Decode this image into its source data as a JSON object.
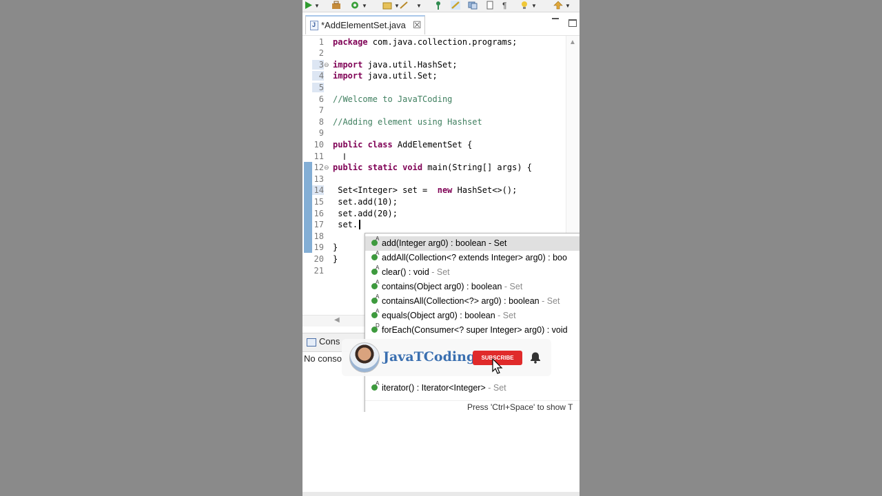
{
  "editor": {
    "tab_title": "*AddElementSet.java",
    "close_glyph": "☒"
  },
  "code": {
    "line_numbers": [
      "1",
      "2",
      "3",
      "4",
      "5",
      "6",
      "7",
      "8",
      "9",
      "10",
      "11",
      "12",
      "13",
      "14",
      "15",
      "16",
      "17",
      "18",
      "19",
      "20",
      "21"
    ],
    "lines": {
      "l1_kw": "package",
      "l1_rest": " com.java.collection.programs;",
      "l3_kw": "import",
      "l3_rest": " java.util.HashSet;",
      "l4_kw": "import",
      "l4_rest": " java.util.Set;",
      "l6": "//Welcome to JavaTCoding",
      "l8": "//Adding element using Hashset",
      "l10_kw": "public class",
      "l10_rest": " AddElementSet {",
      "l12_kw": "public static void",
      "l12_rest": " main(String[] args) {",
      "l14_a": " Set<Integer> set =  ",
      "l14_kw": "new",
      "l14_b": " HashSet<>();",
      "l15": " set.add(10);",
      "l16": " set.add(20);",
      "l17": " set.",
      "l19": "}",
      "l20": "}"
    }
  },
  "assist": {
    "items": [
      {
        "sig": "add(Integer arg0) : boolean",
        "owner": " - Set",
        "sup": "A"
      },
      {
        "sig": "addAll(Collection<? extends Integer> arg0) : boo",
        "owner": "",
        "sup": "A"
      },
      {
        "sig": "clear() : void",
        "owner": " - Set",
        "sup": "A"
      },
      {
        "sig": "contains(Object arg0) : boolean",
        "owner": " - Set",
        "sup": "A"
      },
      {
        "sig": "containsAll(Collection<?> arg0) : boolean",
        "owner": " - Set",
        "sup": "A"
      },
      {
        "sig": "equals(Object arg0) : boolean",
        "owner": " - Set",
        "sup": "A"
      },
      {
        "sig": "forEach(Consumer<? super Integer> arg0) : void",
        "owner": "",
        "sup": "D"
      },
      {
        "sig": "iterator() : Iterator<Integer>",
        "owner": " - Set",
        "sup": "A"
      }
    ],
    "hint": "Press 'Ctrl+Space' to show T"
  },
  "console": {
    "tab_label": "Cons",
    "message": "No conso"
  },
  "overlay": {
    "channel_name": "JavaTCoding",
    "subscribe_label": "SUBSCRIBE"
  },
  "colors": {
    "keyword": "#7f0055",
    "comment": "#3f7f5f",
    "method_icon": "#3e9a3e",
    "subscribe": "#e02a2a",
    "channel": "#3a6fb0"
  }
}
